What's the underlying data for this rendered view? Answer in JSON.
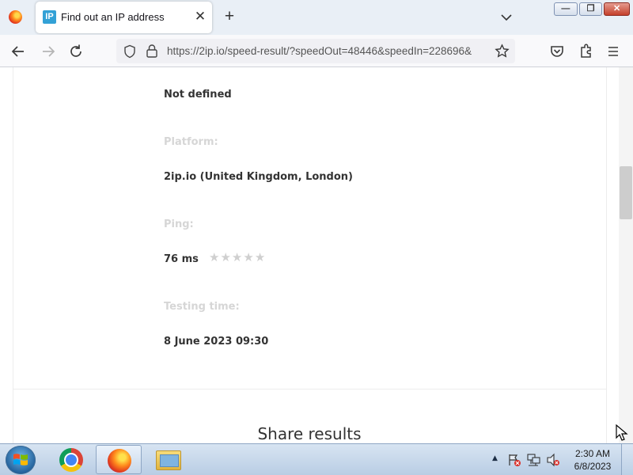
{
  "browser": {
    "tab": {
      "title": "Find out an IP address",
      "favicon_text": "IP",
      "close_glyph": "✕"
    },
    "new_tab_glyph": "+",
    "url": "https://2ip.io/speed-result/?speedOut=48446&speedIn=228696&",
    "nav_icons": [
      "back-arrow-icon",
      "forward-arrow-icon",
      "reload-icon",
      "shield-icon",
      "lock-icon",
      "bookmark-star-icon",
      "pocket-icon",
      "extensions-icon",
      "menu-icon"
    ],
    "window_buttons": {
      "minimize": "—",
      "restore": "❐",
      "close": "✕"
    }
  },
  "page": {
    "top_value": "Not defined",
    "platform": {
      "label": "Platform:",
      "value": "2ip.io (United Kingdom, London)"
    },
    "ping": {
      "label": "Ping:",
      "value": "76 ms",
      "rating_filled": 0,
      "rating_max": 5
    },
    "testing_time": {
      "label": "Testing time:",
      "value": "8 June 2023 09:30"
    },
    "share_title": "Share results"
  },
  "taskbar": {
    "clock_time": "2:30 AM",
    "clock_date": "6/8/2023",
    "tray_arrow": "▲",
    "apps": [
      "chrome",
      "firefox",
      "file-explorer"
    ]
  },
  "colors": {
    "label_gray": "#d6d6d6",
    "value_text": "#333333",
    "star_gray": "#cfcfcf",
    "taskbar_top": "#d7e4f2"
  }
}
